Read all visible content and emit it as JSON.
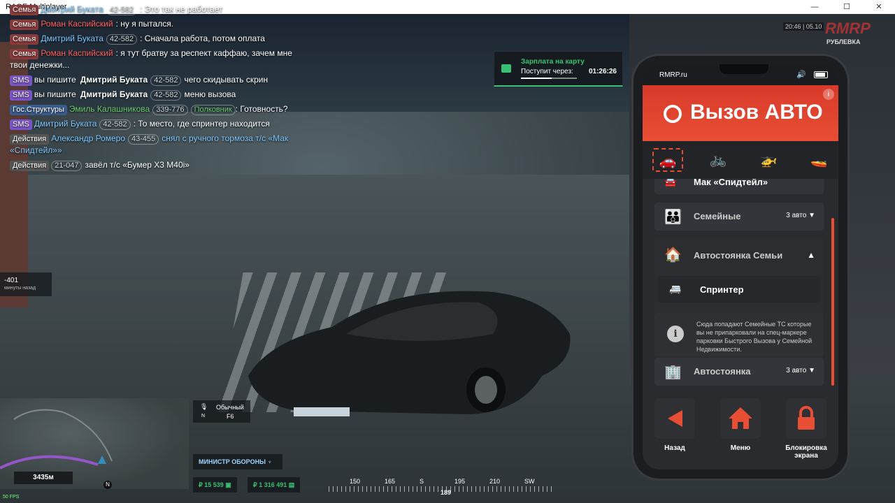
{
  "window": {
    "title": "RAGE Multiplayer"
  },
  "chat": [
    {
      "tag": "Семья",
      "tagType": "fam",
      "name": "Дмитрий Буката",
      "id": "42-582",
      "text": ": Это так не работает"
    },
    {
      "tag": "Семья",
      "tagType": "fam",
      "name": "Роман Каспийский",
      "nameColor": "red",
      "id": "",
      "text": ": ну я пытался."
    },
    {
      "tag": "Семья",
      "tagType": "fam",
      "name": "Дмитрий Буката",
      "id": "42-582",
      "text": ": Сначала работа, потом оплата"
    },
    {
      "tag": "Семья",
      "tagType": "fam",
      "name": "Роман Каспийский",
      "nameColor": "red",
      "id": "",
      "text": ": я тут братву за респект каффаю, зачем мне твои денежки..."
    },
    {
      "tag": "SMS",
      "tagType": "sms",
      "pre": "вы пишите",
      "name": "Дмитрий Буката",
      "nameColor": "bold",
      "id": "42-582",
      "text": "чего скидывать скрин"
    },
    {
      "tag": "SMS",
      "tagType": "sms",
      "pre": "вы пишите",
      "name": "Дмитрий Буката",
      "nameColor": "bold",
      "id": "42-582",
      "text": "меню вызова"
    },
    {
      "tag": "Гос.Структуры",
      "tagType": "gov",
      "name": "Эмиль Калашникова",
      "nameColor": "green",
      "id": "339-776",
      "rank": "Полковник",
      "text": ": Готовность?"
    },
    {
      "tag": "SMS",
      "tagType": "sms",
      "name": "Дмитрий Буката",
      "id": "42-582",
      "text": ": То место, где спринтер находится"
    },
    {
      "tag": "Действия",
      "tagType": "act",
      "name": "Александр Ромеро",
      "id": "43-455",
      "text": "снял с ручного тормоза т/с «Мак «Спидтейл»»",
      "textColor": "blue"
    },
    {
      "tag": "Действия",
      "tagType": "act",
      "name": "",
      "id": "21-047",
      "text": "завёл т/с «Бумер X3 M40i»"
    }
  ],
  "salary": {
    "title": "Зарплата на карту",
    "label": "Поступит через:",
    "timer": "01:26:26",
    "progress": 0.55
  },
  "brand": {
    "logo": "RMRP",
    "server": "РУБЛЕВКА",
    "clock": "20:46 | 05.10"
  },
  "phone": {
    "site": "RMRP.ru",
    "title": "Вызов АВТО",
    "categories": [
      {
        "icon": "car-icon",
        "glyph": "🚗",
        "selected": true
      },
      {
        "icon": "bicycle-icon",
        "glyph": "🚲",
        "selected": false
      },
      {
        "icon": "helicopter-icon",
        "glyph": "🚁",
        "selected": false
      },
      {
        "icon": "boat-icon",
        "glyph": "🚤",
        "selected": false
      }
    ],
    "top_item": "Мак «Спидтейл»",
    "family": {
      "label": "Семейные",
      "count": "3 авто"
    },
    "family_parking": {
      "label": "Автостоянка Семьи",
      "expanded": true,
      "vehicle": "Спринтер",
      "note": "Сюда попадают Семейные ТС которые вы не припарковали на спец-маркере парковки Быстрого Вызова у Семейной Недвижимости."
    },
    "parking": {
      "label": "Автостоянка",
      "count": "3 авто"
    },
    "nav": [
      {
        "label": "Назад"
      },
      {
        "label": "Меню"
      },
      {
        "label": "Блокировка экрана"
      }
    ],
    "accent": "#e84e34"
  },
  "hud": {
    "voice_mode": "Обычный",
    "voice_key": "F6",
    "voice_sub": "N",
    "role": "МИНИСТР ОБОРОНЫ",
    "cash": "₽ 15 539",
    "bank": "₽ 1 316 491",
    "distance": "3435м",
    "fps": "50 FPS",
    "ping_id": "-401",
    "ping_text": "минуты назад",
    "compass": [
      "150",
      "165",
      "S",
      "195",
      "210",
      "SW"
    ],
    "heading": "189",
    "north": "N"
  }
}
